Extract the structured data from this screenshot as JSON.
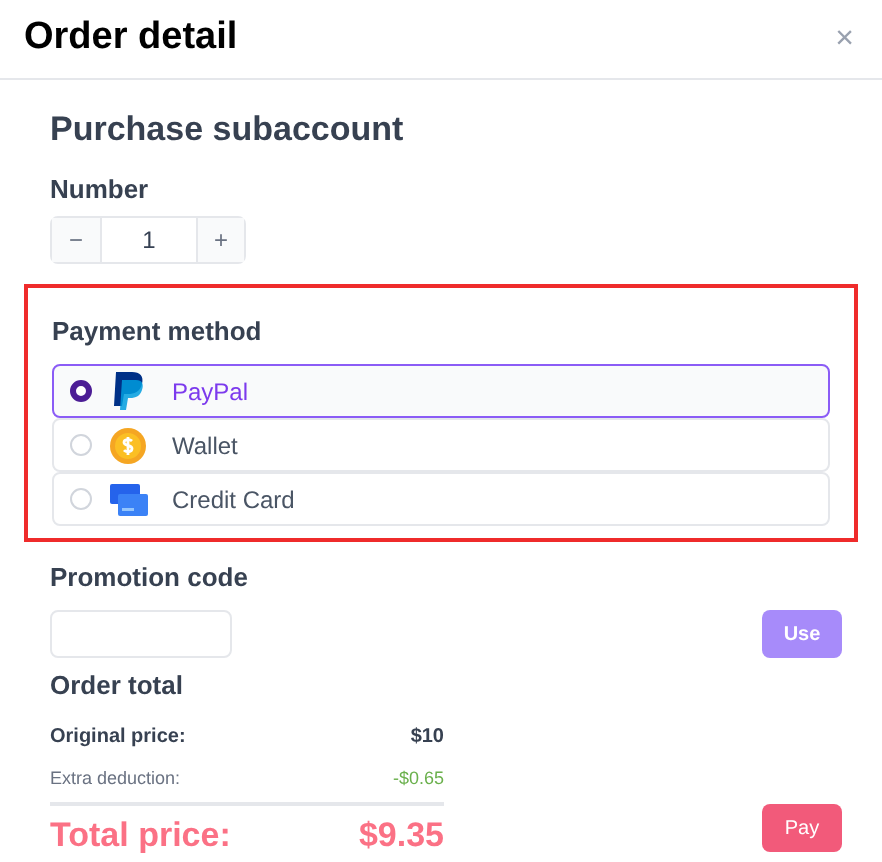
{
  "dialog": {
    "title": "Order detail",
    "close": "×"
  },
  "section_title": "Purchase subaccount",
  "number": {
    "label": "Number",
    "minus": "−",
    "value": "1",
    "plus": "+"
  },
  "payment": {
    "label": "Payment method",
    "highlighted": true,
    "methods": [
      {
        "label": "PayPal",
        "kind": "paypal",
        "selected": true
      },
      {
        "label": "Wallet",
        "kind": "wallet",
        "selected": false
      },
      {
        "label": "Credit Card",
        "kind": "card",
        "selected": false
      }
    ]
  },
  "promotion": {
    "label": "Promotion code",
    "button": "Use"
  },
  "order_total": {
    "title": "Order total",
    "original_label": "Original price:",
    "original_value": "$10",
    "deduction_label": "Extra deduction:",
    "deduction_value": "-$0.65",
    "total_label": "Total price:",
    "total_value": "$9.35",
    "pay_button": "Pay"
  }
}
